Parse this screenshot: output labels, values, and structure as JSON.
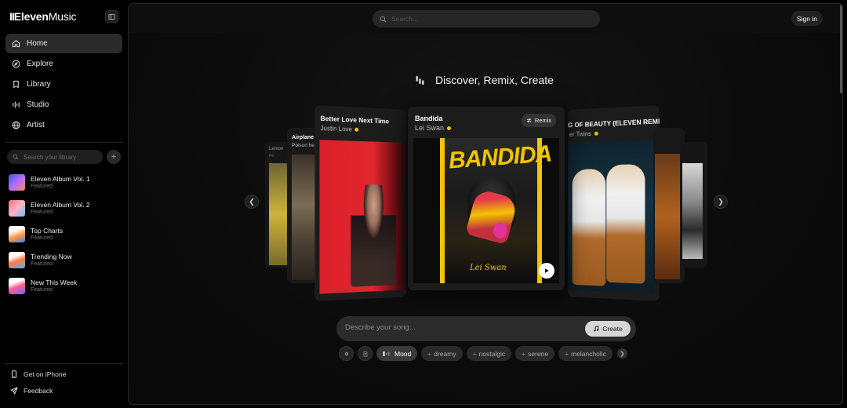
{
  "app": {
    "logo_bold": "Eleven",
    "logo_rest": "Music"
  },
  "sidebar": {
    "nav": [
      {
        "label": "Home",
        "icon": "home-icon",
        "active": true
      },
      {
        "label": "Explore",
        "icon": "compass-icon",
        "active": false
      },
      {
        "label": "Library",
        "icon": "bookmark-icon",
        "active": false
      },
      {
        "label": "Studio",
        "icon": "equalizer-icon",
        "active": false
      },
      {
        "label": "Artist",
        "icon": "globe-icon",
        "active": false
      }
    ],
    "library_search_placeholder": "Search your library",
    "playlists": [
      {
        "name": "Eleven Album Vol. 1",
        "sub": "Featured",
        "color": "#6a8cff"
      },
      {
        "name": "Eleven Album Vol. 2",
        "sub": "Featured",
        "color": "#ff6b8b"
      },
      {
        "name": "Top Charts",
        "sub": "Featured",
        "color": "#ff9a3c"
      },
      {
        "name": "Trending Now",
        "sub": "Featured",
        "color": "#4fb6ff"
      },
      {
        "name": "New This Week",
        "sub": "Featured",
        "color": "#b36bff"
      }
    ],
    "bottom_links": [
      {
        "label": "Get on iPhone",
        "icon": "phone-icon"
      },
      {
        "label": "Feedback",
        "icon": "send-icon"
      }
    ]
  },
  "topbar": {
    "search_placeholder": "Search...",
    "signin_label": "Sign in"
  },
  "hero": {
    "headline": "Discover, Remix, Create"
  },
  "carousel": {
    "center": {
      "title": "Bandida",
      "artist": "Lei Swan",
      "remix_label": "Remix",
      "cover_text": "BANDIDA",
      "cover_signature": "Lei Swan"
    },
    "left1": {
      "title": "Better Love Next Time",
      "artist": "Justin Love"
    },
    "left2": {
      "title": "Airplane M",
      "artist": "Poison he"
    },
    "left3": {
      "title": "Lemon",
      "artist": "Ro"
    },
    "right1": {
      "title": "G OF BEAUTY (ELEVEN REMIX)",
      "artist": "er Twins"
    }
  },
  "prompt": {
    "placeholder": "Describe your song...",
    "create_label": "Create"
  },
  "tags": {
    "mood_label": "Mood",
    "chips": [
      "dreamy",
      "nostalgic",
      "serene",
      "melancholic"
    ]
  },
  "colors": {
    "accent_yellow": "#f2c400",
    "active_nav": "#2a2a2a"
  }
}
